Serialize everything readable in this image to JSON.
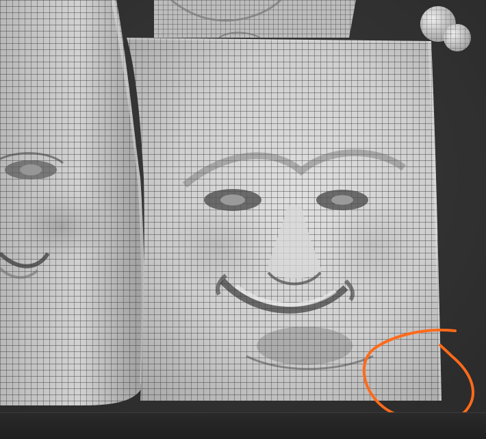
{
  "scene": {
    "description_hidden": "",
    "background_color": "#2c2c2c",
    "mesh_color": "#c9c9c9",
    "wire_color": "#2a2a2a",
    "annotation_color": "#ff6a1a",
    "annotation_shape": "circle-highlight",
    "objects": [
      {
        "name": "left-face-block",
        "kind": "sculpted mesh"
      },
      {
        "name": "right-face-block",
        "kind": "sculpted mesh"
      },
      {
        "name": "top-center-object",
        "kind": "sculpted mesh"
      },
      {
        "name": "top-right-sphere-object",
        "kind": "sculpted mesh"
      }
    ]
  }
}
